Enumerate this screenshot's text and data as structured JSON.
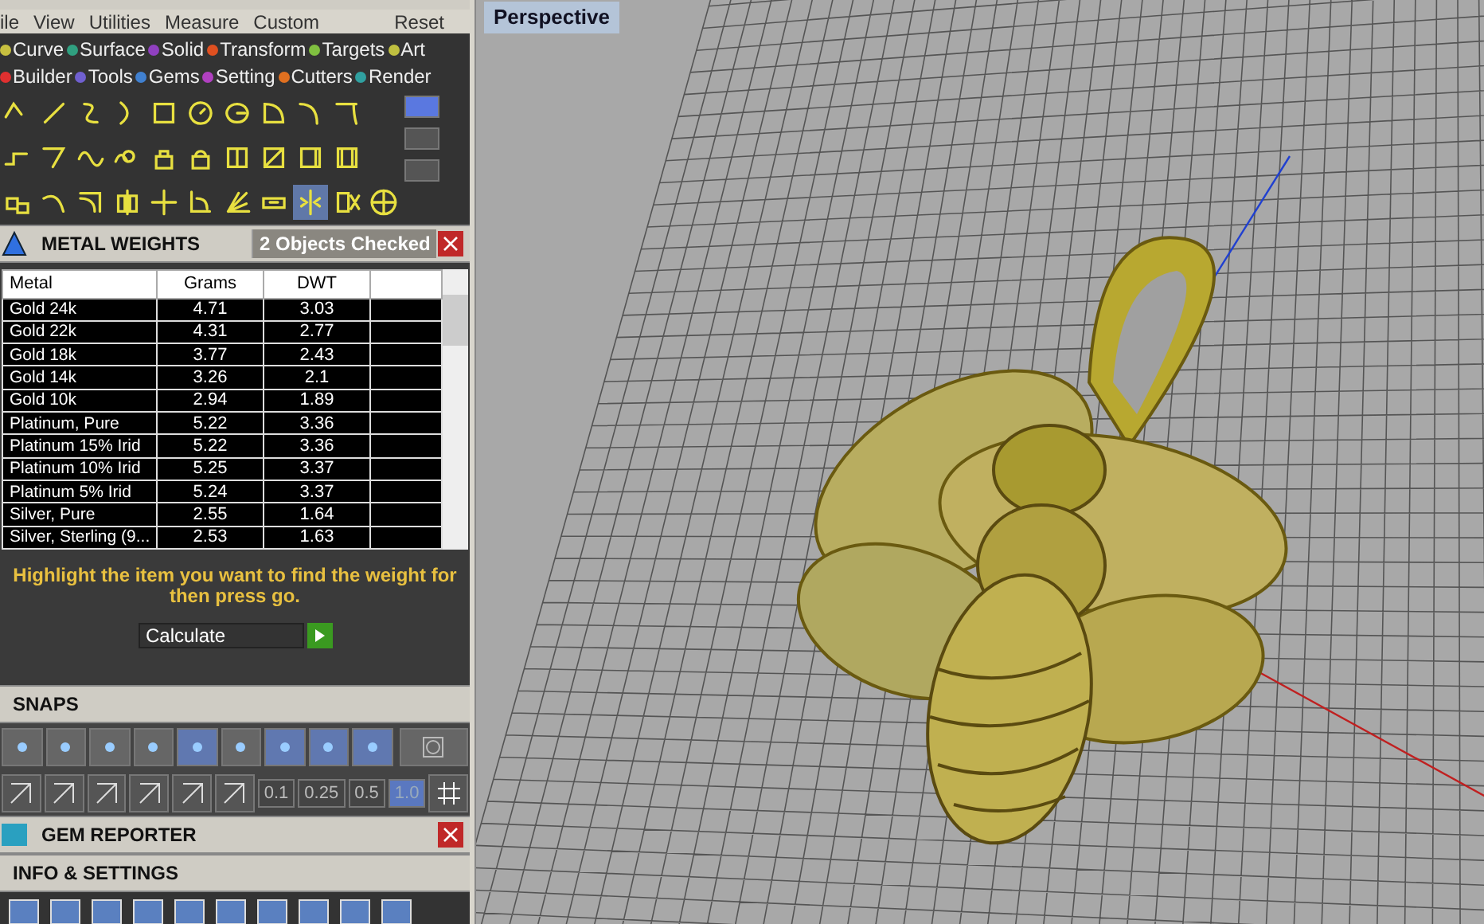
{
  "menu": [
    "ile",
    "View",
    "Utilities",
    "Measure",
    "Custom"
  ],
  "menu_reset": "Reset",
  "categories": [
    {
      "label": "Curve",
      "color": "#c8c040"
    },
    {
      "label": "Surface",
      "color": "#30a080"
    },
    {
      "label": "Solid",
      "color": "#9040c0"
    },
    {
      "label": "Transform",
      "color": "#e05020"
    },
    {
      "label": "Targets",
      "color": "#80c040"
    },
    {
      "label": "Art",
      "color": "#c0c040"
    },
    {
      "label": "Builder",
      "color": "#e03030"
    },
    {
      "label": "Tools",
      "color": "#7060d0"
    },
    {
      "label": "Gems",
      "color": "#4080d0"
    },
    {
      "label": "Setting",
      "color": "#b040c0"
    },
    {
      "label": "Cutters",
      "color": "#e07020"
    },
    {
      "label": "Render",
      "color": "#30a0a0"
    }
  ],
  "side_toggles": [
    {
      "selected": true
    },
    {
      "selected": false
    },
    {
      "selected": false
    }
  ],
  "metal_weights": {
    "title": "METAL WEIGHTS",
    "status": "2 Objects Checked",
    "columns": [
      "Metal",
      "Grams",
      "DWT"
    ],
    "rows": [
      [
        "Gold 24k",
        "4.71",
        "3.03"
      ],
      [
        "Gold 22k",
        "4.31",
        "2.77"
      ],
      [
        "Gold 18k",
        "3.77",
        "2.43"
      ],
      [
        "Gold 14k",
        "3.26",
        "2.1"
      ],
      [
        "Gold 10k",
        "2.94",
        "1.89"
      ],
      [
        "Platinum, Pure",
        "5.22",
        "3.36"
      ],
      [
        "Platinum 15% Irid",
        "5.22",
        "3.36"
      ],
      [
        "Platinum 10% Irid",
        "5.25",
        "3.37"
      ],
      [
        "Platinum 5% Irid",
        "5.24",
        "3.37"
      ],
      [
        "Silver, Pure",
        "2.55",
        "1.64"
      ],
      [
        "Silver, Sterling (9...",
        "2.53",
        "1.63"
      ]
    ],
    "instruction": "Highlight the item you want to find the weight for then press go.",
    "calculate": "Calculate"
  },
  "snaps": {
    "title": "SNAPS",
    "buttons": [
      {
        "on": false
      },
      {
        "on": false
      },
      {
        "on": false
      },
      {
        "on": false
      },
      {
        "on": true
      },
      {
        "on": false
      },
      {
        "on": true
      },
      {
        "on": true
      },
      {
        "on": true
      }
    ],
    "grid_sizes": [
      {
        "label": "0.1",
        "selected": false
      },
      {
        "label": "0.25",
        "selected": false
      },
      {
        "label": "0.5",
        "selected": false
      },
      {
        "label": "1.0",
        "selected": true
      }
    ]
  },
  "gem_reporter": {
    "title": "GEM REPORTER"
  },
  "info_settings": {
    "title": "INFO & SETTINGS"
  },
  "viewport": {
    "title": "Perspective"
  }
}
